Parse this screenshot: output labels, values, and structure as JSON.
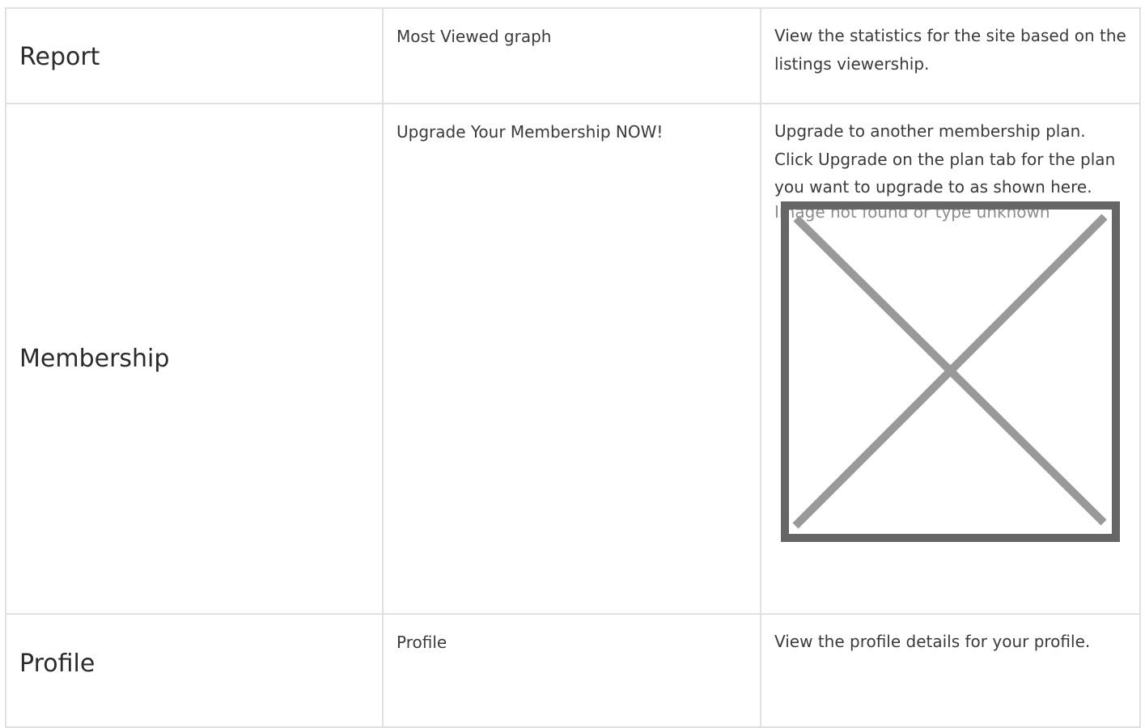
{
  "rows": [
    {
      "section": "Report",
      "feature": "Most Viewed graph",
      "description": "View the statistics for the site based on the listings viewership."
    },
    {
      "section": "Membership",
      "feature": "Upgrade Your Membership NOW!",
      "description": "Upgrade to another membership plan. Click Upgrade on the plan tab for the plan you want to upgrade to as shown here.",
      "image_alt": "Image not found or type unknown",
      "image_icon": "broken-image-icon"
    },
    {
      "section": "Profile",
      "feature": "Profile",
      "description": "View the profile details for your profile."
    }
  ],
  "colors": {
    "border": "#e0e0e0",
    "text": "#333333",
    "placeholder_frame": "#666666",
    "placeholder_cross": "#999999",
    "placeholder_text": "#8c8c8c"
  }
}
